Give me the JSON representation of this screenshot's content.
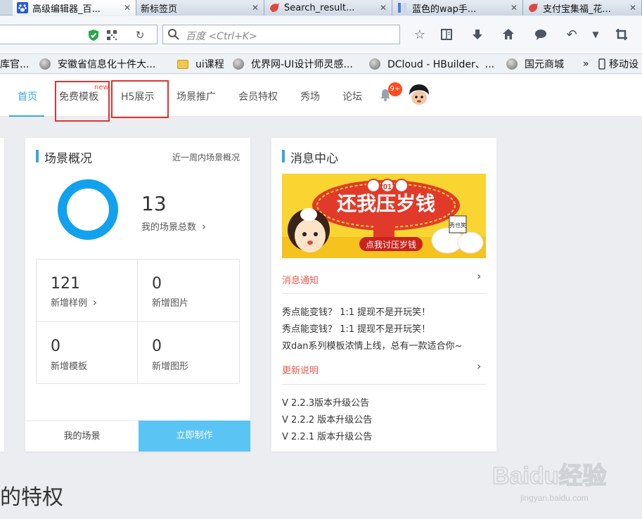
{
  "browser": {
    "tabs": [
      {
        "title": "高级编辑器_百...",
        "active": true
      },
      {
        "title": "新标签页",
        "active": false
      },
      {
        "title": "Search_result...",
        "active": false
      },
      {
        "title": "蓝色的wap手...",
        "active": false
      },
      {
        "title": "支付宝集福_花...",
        "active": false
      }
    ],
    "search_placeholder": "百度 <Ctrl+K>",
    "bookmarks": [
      "库官...",
      "安徽省信息化十件大...",
      "ui课程",
      "优界网-UI设计师灵感...",
      "DCloud - HBuilder、...",
      "国元商城",
      "»",
      "移动设"
    ]
  },
  "site_nav": {
    "items": [
      "首页",
      "免费模板",
      "H5展示",
      "场景推广",
      "会员特权",
      "秀场",
      "论坛"
    ],
    "new_tag": "new",
    "badge": "9+"
  },
  "overview": {
    "title": "场景概况",
    "subtitle": "近一周内场景概况",
    "total": "13",
    "total_label": "我的场景总数",
    "stats": [
      {
        "value": "121",
        "label": "新增样例"
      },
      {
        "value": "0",
        "label": "新增图片"
      },
      {
        "value": "0",
        "label": "新增模板"
      },
      {
        "value": "0",
        "label": "新增图形"
      }
    ],
    "my_scenes": "我的场景",
    "create_now": "立即制作"
  },
  "messages": {
    "title": "消息中心",
    "banner": {
      "year": "2017",
      "headline": "还我压岁钱",
      "button": "点我讨压岁钱",
      "tag": "秀也笑"
    },
    "notice_header": "消息通知",
    "notices": [
      "秀点能变钱？ 1:1 提现不是开玩笑！",
      "秀点能变钱？ 1:1 提现不是开玩笑！",
      "双dan系列模板浓情上线，总有一款适合你~"
    ],
    "update_header": "更新说明",
    "updates": [
      "V 2.2.3版本升级公告",
      "V 2.2.2 版本升级公告",
      "V 2.2.1 版本升级公告"
    ]
  },
  "footer_heading": "的特权",
  "watermark": {
    "brand": "Baidu经验",
    "url": "jingyan.baidu.com"
  },
  "colors": {
    "accent": "#3aa6dd",
    "ring": "#11a1ee",
    "button": "#5ac4f4",
    "alert": "#e85a4f",
    "highlight_box": "#e03232"
  }
}
